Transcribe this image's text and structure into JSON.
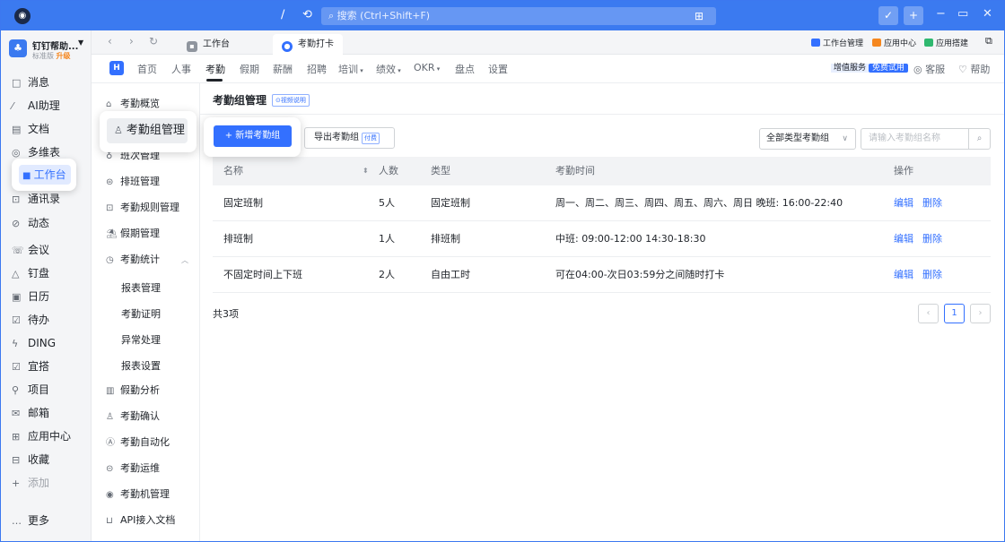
{
  "titlebar": {
    "search_placeholder": "搜索 (Ctrl+Shift+F)",
    "icons": [
      "app-logo",
      "slash-icon",
      "history-icon",
      "search-icon",
      "grid-icon",
      "quick-icon",
      "plus-icon",
      "minimize-icon",
      "restore-icon",
      "close-icon"
    ]
  },
  "user": {
    "name": "钉钉帮助...",
    "edition": "标准版",
    "upgrade": "升级"
  },
  "leftnav": [
    {
      "label": "消息"
    },
    {
      "label": "AI助理"
    },
    {
      "label": "文档"
    },
    {
      "label": "多维表"
    },
    {
      "label": "工作台",
      "active": true
    },
    {
      "label": "通讯录"
    },
    {
      "label": "动态"
    },
    {
      "label": "会议"
    },
    {
      "label": "钉盘"
    },
    {
      "label": "日历"
    },
    {
      "label": "待办"
    },
    {
      "label": "DING"
    },
    {
      "label": "宜搭"
    },
    {
      "label": "项目"
    },
    {
      "label": "邮箱"
    },
    {
      "label": "应用中心"
    },
    {
      "label": "收藏"
    },
    {
      "label": "添加"
    },
    {
      "label": "更多"
    }
  ],
  "tabs": [
    {
      "label": "工作台"
    },
    {
      "label": "考勤打卡",
      "active": true
    }
  ],
  "tab_right": {
    "workbench_manage": "工作台管理",
    "app_center": "应用中心",
    "app_build": "应用搭建"
  },
  "modnav": {
    "items": [
      "首页",
      "人事",
      "考勤",
      "假期",
      "薪酬",
      "招聘",
      "培训",
      "绩效",
      "OKR",
      "盘点",
      "设置"
    ],
    "active": "考勤",
    "value_service": "增值服务",
    "free_trial": "免费试用",
    "support": "客服",
    "help": "帮助"
  },
  "subside": {
    "items": [
      "考勤概览",
      "考勤组管理",
      "班次管理",
      "排班管理",
      "考勤规则管理",
      "假期管理",
      "考勤统计"
    ],
    "stats_children": [
      "报表管理",
      "考勤证明",
      "异常处理",
      "报表设置"
    ],
    "more_items": [
      "假勤分析",
      "考勤确认",
      "考勤自动化",
      "考勤运维",
      "考勤机管理",
      "API接入文档"
    ],
    "active": "考勤组管理"
  },
  "main": {
    "title": "考勤组管理",
    "video_tag": "⊙视频说明",
    "add_button": "+ 新增考勤组",
    "export_button": "导出考勤组",
    "paid_tag": "付费",
    "type_select": "全部类型考勤组",
    "search_placeholder": "请输入考勤组名称",
    "columns": [
      "名称",
      "人数",
      "类型",
      "考勤时间",
      "操作"
    ],
    "rows": [
      {
        "name": "固定班制",
        "count": "5人",
        "type": "固定班制",
        "time": "周一、周二、周三、周四、周五、周六、周日  晚班: 16:00-22:40",
        "edit": "编辑",
        "delete": "删除"
      },
      {
        "name": "排班制",
        "count": "1人",
        "type": "排班制",
        "time": "中班: 09:00-12:00 14:30-18:30",
        "edit": "编辑",
        "delete": "删除"
      },
      {
        "name": "不固定时间上下班",
        "count": "2人",
        "type": "自由工时",
        "time": "可在04:00-次日03:59分之间随时打卡",
        "edit": "编辑",
        "delete": "删除"
      }
    ],
    "total": "共3项",
    "current_page": "1"
  },
  "colors": {
    "accent": "#3370ff",
    "titlebar": "#3b7af0"
  }
}
